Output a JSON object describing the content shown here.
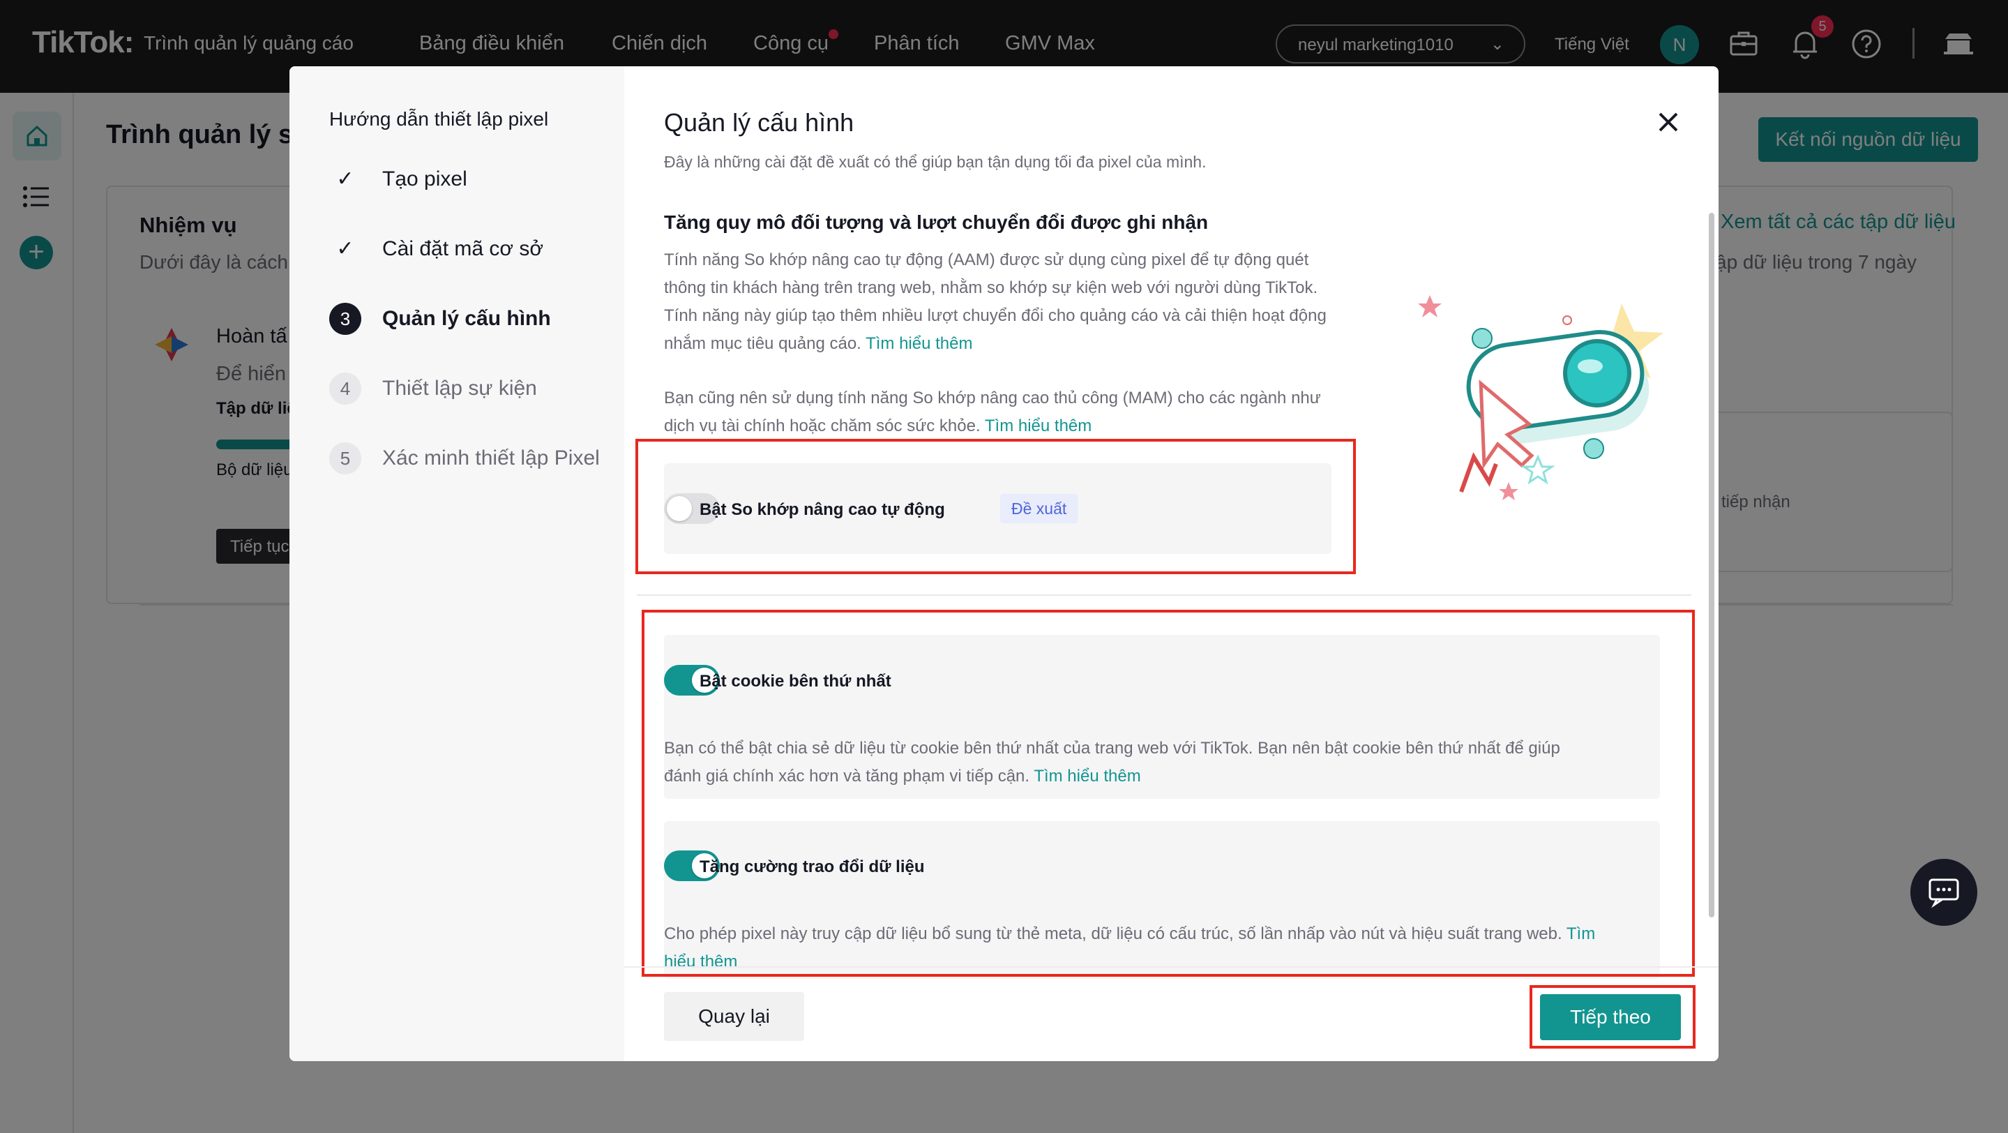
{
  "topbar": {
    "logo": "TikTok:",
    "logo_sub": "Trình quản lý quảng cáo",
    "nav": [
      "Bảng điều khiển",
      "Chiến dịch",
      "Công cụ",
      "Phân tích",
      "GMV Max"
    ],
    "account": "neyul marketing1010",
    "language": "Tiếng Việt",
    "avatar_initial": "N",
    "notification_count": "5"
  },
  "background": {
    "page_title": "Trình quản lý s",
    "connect_button": "Kết nối nguồn dữ liệu",
    "tasks_title": "Nhiệm vụ",
    "tasks_sub": "Dưới đây là cách",
    "done": "Hoàn tấ",
    "show": "Để hiển",
    "dataset": "Tập dữ liệ",
    "bo": "Bộ dữ liệu",
    "continue": "Tiếp tục",
    "see_all": "Xem tất cả các tập dữ liệu",
    "seven_days": "ập dữ liệu trong 7 ngày",
    "received": "tiếp nhận"
  },
  "steps": {
    "title": "Hướng dẫn thiết lập pixel",
    "items": [
      {
        "mark": "✓",
        "label": "Tạo pixel"
      },
      {
        "mark": "✓",
        "label": "Cài đặt mã cơ sở"
      },
      {
        "mark": "3",
        "label": "Quản lý cấu hình"
      },
      {
        "mark": "4",
        "label": "Thiết lập sự kiện"
      },
      {
        "mark": "5",
        "label": "Xác minh thiết lập Pixel"
      }
    ]
  },
  "modal": {
    "title": "Quản lý cấu hình",
    "subtitle": "Đây là những cài đặt đề xuất có thể giúp bạn tận dụng tối đa pixel của mình.",
    "section_title": "Tăng quy mô đối tượng và lượt chuyển đổi được ghi nhận",
    "para1": "Tính năng So khớp nâng cao tự động (AAM) được sử dụng cùng pixel để tự động quét thông tin khách hàng trên trang web, nhằm so khớp sự kiện web với người dùng TikTok. Tính năng này giúp tạo thêm nhiều lượt chuyển đổi cho quảng cáo và cải thiện hoạt động nhắm mục tiêu quảng cáo.",
    "para2": "Bạn cũng nên sử dụng tính năng So khớp nâng cao thủ công (MAM) cho các ngành như dịch vụ tài chính hoặc chăm sóc sức khỏe.",
    "learn_more": "Tìm hiểu thêm",
    "options": [
      {
        "label": "Bật So khớp nâng cao tự động",
        "tag": "Đề xuất",
        "enabled": false
      },
      {
        "label": "Bật cookie bên thứ nhất",
        "enabled": true,
        "desc": "Bạn có thể bật chia sẻ dữ liệu từ cookie bên thứ nhất của trang web với TikTok. Bạn nên bật cookie bên thứ nhất để giúp đánh giá chính xác hơn và tăng phạm vi tiếp cận."
      },
      {
        "label": "Tăng cường trao đổi dữ liệu",
        "enabled": true,
        "desc": "Cho phép pixel này truy cập dữ liệu bổ sung từ thẻ meta, dữ liệu có cấu trúc, số lần nhấp vào nút và hiệu suất trang web."
      }
    ],
    "back_button": "Quay lại",
    "next_button": "Tiếp theo"
  },
  "colors": {
    "accent": "#129590",
    "highlight_box": "#e8281e",
    "topbar": "#1c1c1f",
    "badge": "#fe2c55"
  }
}
